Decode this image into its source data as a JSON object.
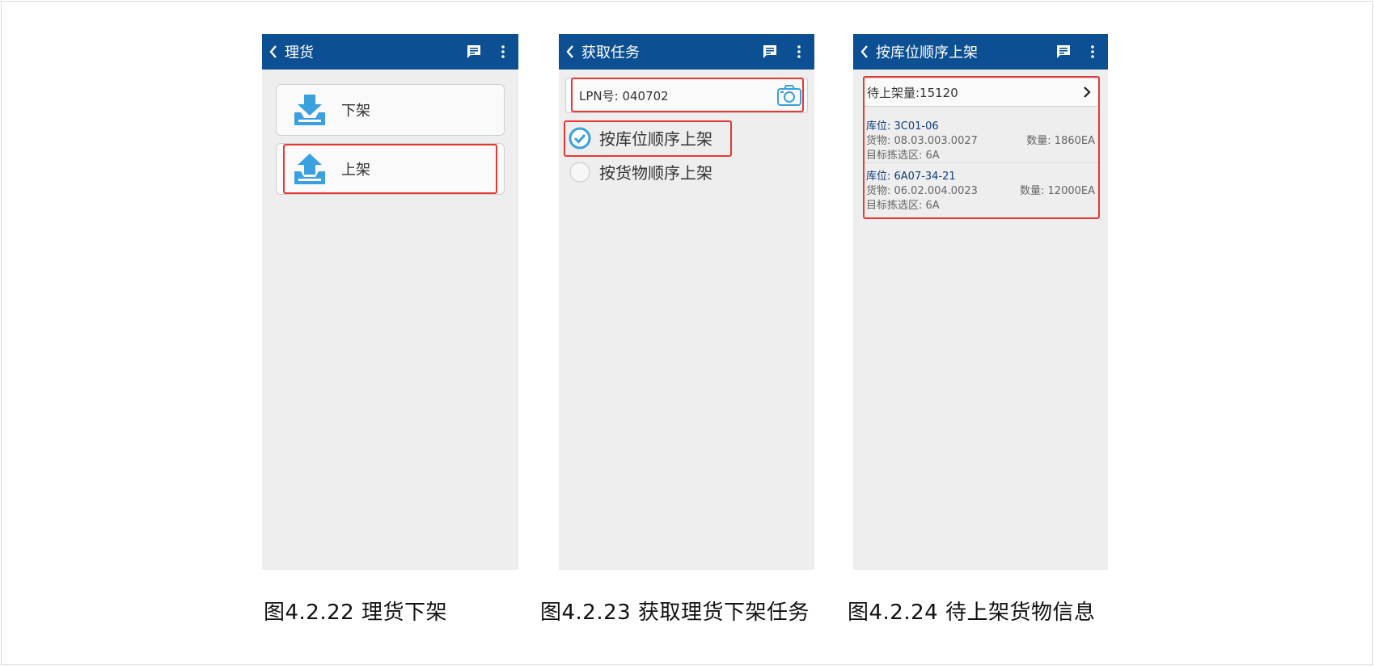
{
  "colors": {
    "appbar": "#0d4f93",
    "highlight": "#e53935",
    "accent": "#3aa0e0",
    "screen_bg": "#eeeeee"
  },
  "screens": [
    {
      "title": "理货",
      "menu": [
        {
          "label": "下架",
          "icon": "download-tray-icon"
        },
        {
          "label": "上架",
          "icon": "upload-tray-icon"
        }
      ]
    },
    {
      "title": "获取任务",
      "lpn_label": "LPN号: 040702",
      "options": [
        {
          "label": "按库位顺序上架",
          "checked": true
        },
        {
          "label": "按货物顺序上架",
          "checked": false
        }
      ]
    },
    {
      "title": "按库位顺序上架",
      "pending": "待上架量:15120",
      "tasks": [
        {
          "location": "库位: 3C01-06",
          "goods": "货物: 08.03.003.0027",
          "qty": "数量: 1860EA",
          "zone": "目标拣选区: 6A"
        },
        {
          "location": "库位: 6A07-34-21",
          "goods": "货物: 06.02.004.0023",
          "qty": "数量: 12000EA",
          "zone": "目标拣选区: 6A"
        }
      ]
    }
  ],
  "captions": [
    "图4.2.22  理货下架",
    "图4.2.23  获取理货下架任务",
    "图4.2.24 待上架货物信息"
  ]
}
